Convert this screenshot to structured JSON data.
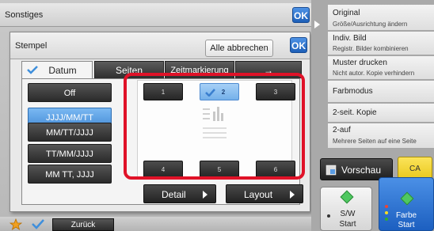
{
  "outer": {
    "title": "Sonstiges",
    "ok_label": "OK"
  },
  "dialog": {
    "title": "Stempel",
    "ok_label": "OK",
    "cancel_all_label": "Alle abbrechen",
    "tabs": [
      {
        "label": "Datum",
        "active": true
      },
      {
        "label": "Seiten",
        "active": false
      },
      {
        "label": "Zeitmarkierung",
        "active": false
      },
      {
        "label": "→",
        "active": false
      }
    ],
    "formats": [
      {
        "label": "Off",
        "selected": false
      },
      {
        "label": "JJJJ/MM/TT",
        "selected": true
      },
      {
        "label": "MM/TT/JJJJ",
        "selected": false
      },
      {
        "label": "TT/MM/JJJJ",
        "selected": false
      },
      {
        "label": "MM TT, JJJJ",
        "selected": false
      }
    ],
    "positions": [
      {
        "label": "1",
        "selected": false
      },
      {
        "label": "2",
        "selected": true
      },
      {
        "label": "3",
        "selected": false
      },
      {
        "label": "4",
        "selected": false
      },
      {
        "label": "5",
        "selected": false
      },
      {
        "label": "6",
        "selected": false
      }
    ],
    "detail_label": "Detail",
    "layout_label": "Layout"
  },
  "bottom_bar": {
    "back_label": "Zurück"
  },
  "right_panel": {
    "items": [
      {
        "main": "Original",
        "sub": "Größe/Ausrichtung ändern"
      },
      {
        "main": "Indiv. Bild",
        "sub": "Registr. Bilder kombinieren"
      },
      {
        "main": "Muster drucken",
        "sub": "Nicht autor. Kopie verhindern"
      },
      {
        "main": "Farbmodus",
        "sub": ""
      },
      {
        "main": "2-seit. Kopie",
        "sub": ""
      },
      {
        "main": "2-auf",
        "sub": "Mehrere Seiten auf eine Seite"
      }
    ],
    "preview_label": "Vorschau",
    "ca_label": "CA",
    "sw_start_line1": "S/W",
    "sw_start_line2": "Start",
    "color_start_line1": "Farbe",
    "color_start_line2": "Start"
  },
  "colors": {
    "accent": "#1d5fb8",
    "selection": "#4c92da",
    "highlight_frame": "#e01228"
  }
}
